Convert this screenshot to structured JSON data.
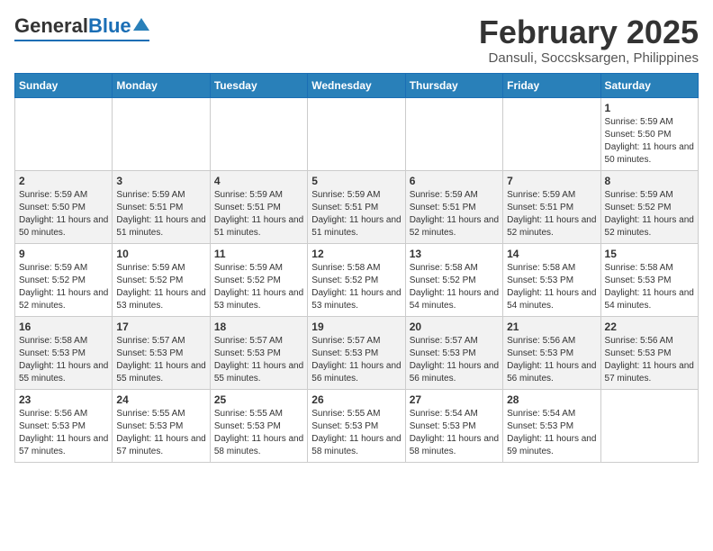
{
  "header": {
    "logo_general": "General",
    "logo_blue": "Blue",
    "month_title": "February 2025",
    "location": "Dansuli, Soccsksargen, Philippines"
  },
  "weekdays": [
    "Sunday",
    "Monday",
    "Tuesday",
    "Wednesday",
    "Thursday",
    "Friday",
    "Saturday"
  ],
  "weeks": [
    [
      {
        "day": "",
        "sunrise": "",
        "sunset": "",
        "daylight": ""
      },
      {
        "day": "",
        "sunrise": "",
        "sunset": "",
        "daylight": ""
      },
      {
        "day": "",
        "sunrise": "",
        "sunset": "",
        "daylight": ""
      },
      {
        "day": "",
        "sunrise": "",
        "sunset": "",
        "daylight": ""
      },
      {
        "day": "",
        "sunrise": "",
        "sunset": "",
        "daylight": ""
      },
      {
        "day": "",
        "sunrise": "",
        "sunset": "",
        "daylight": ""
      },
      {
        "day": "1",
        "sunrise": "Sunrise: 5:59 AM",
        "sunset": "Sunset: 5:50 PM",
        "daylight": "Daylight: 11 hours and 50 minutes."
      }
    ],
    [
      {
        "day": "2",
        "sunrise": "Sunrise: 5:59 AM",
        "sunset": "Sunset: 5:50 PM",
        "daylight": "Daylight: 11 hours and 50 minutes."
      },
      {
        "day": "3",
        "sunrise": "Sunrise: 5:59 AM",
        "sunset": "Sunset: 5:51 PM",
        "daylight": "Daylight: 11 hours and 51 minutes."
      },
      {
        "day": "4",
        "sunrise": "Sunrise: 5:59 AM",
        "sunset": "Sunset: 5:51 PM",
        "daylight": "Daylight: 11 hours and 51 minutes."
      },
      {
        "day": "5",
        "sunrise": "Sunrise: 5:59 AM",
        "sunset": "Sunset: 5:51 PM",
        "daylight": "Daylight: 11 hours and 51 minutes."
      },
      {
        "day": "6",
        "sunrise": "Sunrise: 5:59 AM",
        "sunset": "Sunset: 5:51 PM",
        "daylight": "Daylight: 11 hours and 52 minutes."
      },
      {
        "day": "7",
        "sunrise": "Sunrise: 5:59 AM",
        "sunset": "Sunset: 5:51 PM",
        "daylight": "Daylight: 11 hours and 52 minutes."
      },
      {
        "day": "8",
        "sunrise": "Sunrise: 5:59 AM",
        "sunset": "Sunset: 5:52 PM",
        "daylight": "Daylight: 11 hours and 52 minutes."
      }
    ],
    [
      {
        "day": "9",
        "sunrise": "Sunrise: 5:59 AM",
        "sunset": "Sunset: 5:52 PM",
        "daylight": "Daylight: 11 hours and 52 minutes."
      },
      {
        "day": "10",
        "sunrise": "Sunrise: 5:59 AM",
        "sunset": "Sunset: 5:52 PM",
        "daylight": "Daylight: 11 hours and 53 minutes."
      },
      {
        "day": "11",
        "sunrise": "Sunrise: 5:59 AM",
        "sunset": "Sunset: 5:52 PM",
        "daylight": "Daylight: 11 hours and 53 minutes."
      },
      {
        "day": "12",
        "sunrise": "Sunrise: 5:58 AM",
        "sunset": "Sunset: 5:52 PM",
        "daylight": "Daylight: 11 hours and 53 minutes."
      },
      {
        "day": "13",
        "sunrise": "Sunrise: 5:58 AM",
        "sunset": "Sunset: 5:52 PM",
        "daylight": "Daylight: 11 hours and 54 minutes."
      },
      {
        "day": "14",
        "sunrise": "Sunrise: 5:58 AM",
        "sunset": "Sunset: 5:53 PM",
        "daylight": "Daylight: 11 hours and 54 minutes."
      },
      {
        "day": "15",
        "sunrise": "Sunrise: 5:58 AM",
        "sunset": "Sunset: 5:53 PM",
        "daylight": "Daylight: 11 hours and 54 minutes."
      }
    ],
    [
      {
        "day": "16",
        "sunrise": "Sunrise: 5:58 AM",
        "sunset": "Sunset: 5:53 PM",
        "daylight": "Daylight: 11 hours and 55 minutes."
      },
      {
        "day": "17",
        "sunrise": "Sunrise: 5:57 AM",
        "sunset": "Sunset: 5:53 PM",
        "daylight": "Daylight: 11 hours and 55 minutes."
      },
      {
        "day": "18",
        "sunrise": "Sunrise: 5:57 AM",
        "sunset": "Sunset: 5:53 PM",
        "daylight": "Daylight: 11 hours and 55 minutes."
      },
      {
        "day": "19",
        "sunrise": "Sunrise: 5:57 AM",
        "sunset": "Sunset: 5:53 PM",
        "daylight": "Daylight: 11 hours and 56 minutes."
      },
      {
        "day": "20",
        "sunrise": "Sunrise: 5:57 AM",
        "sunset": "Sunset: 5:53 PM",
        "daylight": "Daylight: 11 hours and 56 minutes."
      },
      {
        "day": "21",
        "sunrise": "Sunrise: 5:56 AM",
        "sunset": "Sunset: 5:53 PM",
        "daylight": "Daylight: 11 hours and 56 minutes."
      },
      {
        "day": "22",
        "sunrise": "Sunrise: 5:56 AM",
        "sunset": "Sunset: 5:53 PM",
        "daylight": "Daylight: 11 hours and 57 minutes."
      }
    ],
    [
      {
        "day": "23",
        "sunrise": "Sunrise: 5:56 AM",
        "sunset": "Sunset: 5:53 PM",
        "daylight": "Daylight: 11 hours and 57 minutes."
      },
      {
        "day": "24",
        "sunrise": "Sunrise: 5:55 AM",
        "sunset": "Sunset: 5:53 PM",
        "daylight": "Daylight: 11 hours and 57 minutes."
      },
      {
        "day": "25",
        "sunrise": "Sunrise: 5:55 AM",
        "sunset": "Sunset: 5:53 PM",
        "daylight": "Daylight: 11 hours and 58 minutes."
      },
      {
        "day": "26",
        "sunrise": "Sunrise: 5:55 AM",
        "sunset": "Sunset: 5:53 PM",
        "daylight": "Daylight: 11 hours and 58 minutes."
      },
      {
        "day": "27",
        "sunrise": "Sunrise: 5:54 AM",
        "sunset": "Sunset: 5:53 PM",
        "daylight": "Daylight: 11 hours and 58 minutes."
      },
      {
        "day": "28",
        "sunrise": "Sunrise: 5:54 AM",
        "sunset": "Sunset: 5:53 PM",
        "daylight": "Daylight: 11 hours and 59 minutes."
      },
      {
        "day": "",
        "sunrise": "",
        "sunset": "",
        "daylight": ""
      }
    ]
  ]
}
